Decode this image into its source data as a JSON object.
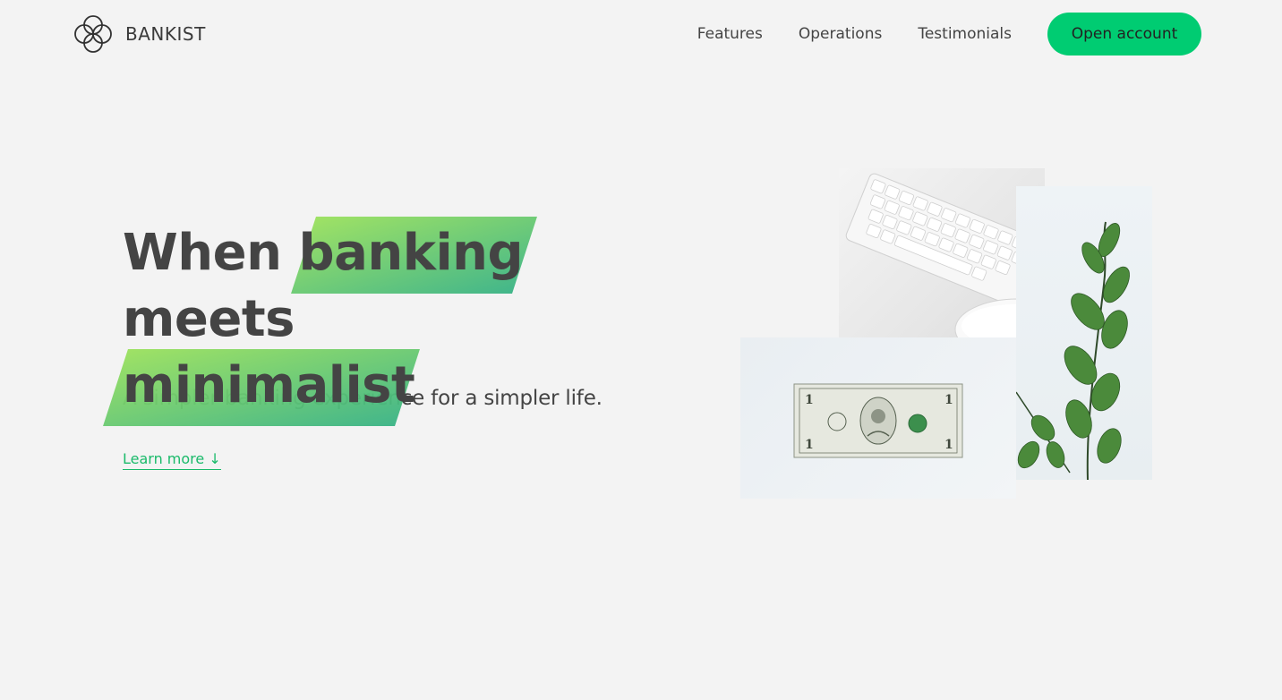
{
  "brand": {
    "name": "BANKIST",
    "logo_icon": "four-circles-logo-icon",
    "accent_color": "#00cc72"
  },
  "nav": {
    "links": [
      "Features",
      "Operations",
      "Testimonials"
    ],
    "cta_label": "Open account"
  },
  "hero": {
    "title_word_1": "When",
    "title_highlight_1": "banking",
    "title_word_2": "meets",
    "title_highlight_2": "minimalist",
    "subtitle": "A simpler banking experience for a simpler life.",
    "learn_more": "Learn more ↓",
    "highlight_gradient": [
      "#9be15d",
      "#39b385"
    ]
  },
  "images": {
    "keyboard": "keyboard-and-mouse-image",
    "plant": "eucalyptus-plant-image",
    "dollar": "dollar-bill-image"
  }
}
